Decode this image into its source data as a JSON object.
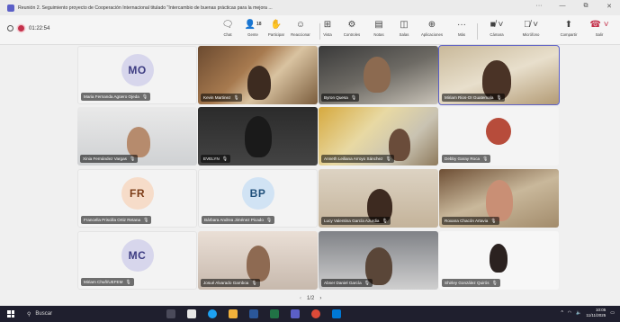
{
  "window": {
    "title": "Reunión 2. Seguimiento proyecto de Cooperación Internacional titulado \"Intercambio de buenas prácticas para la mejora ...",
    "controls": [
      "···",
      "—",
      "⧉",
      "✕"
    ]
  },
  "meeting": {
    "timer": "01:22:54",
    "toolbar": [
      {
        "id": "chat",
        "label": "Chat",
        "icon": "chat-icon"
      },
      {
        "id": "people",
        "label": "Gente",
        "icon": "people-icon",
        "count": "18"
      },
      {
        "id": "raise",
        "label": "Participar",
        "icon": "hand-icon"
      },
      {
        "id": "react",
        "label": "Reaccionar",
        "icon": "smile-icon"
      },
      {
        "id": "view",
        "label": "Vista",
        "icon": "view-icon"
      },
      {
        "id": "controls",
        "label": "Controles",
        "icon": "controls-icon"
      },
      {
        "id": "notes",
        "label": "Notas",
        "icon": "notes-icon"
      },
      {
        "id": "rooms",
        "label": "Salas",
        "icon": "rooms-icon"
      },
      {
        "id": "apps",
        "label": "Aplicaciones",
        "icon": "apps-icon"
      },
      {
        "id": "more",
        "label": "Más",
        "icon": "more-icon"
      },
      {
        "id": "camera",
        "label": "Cámara",
        "icon": "camera-off-icon"
      },
      {
        "id": "mic",
        "label": "Micrófono",
        "icon": "mic-off-icon"
      },
      {
        "id": "share",
        "label": "Compartir",
        "icon": "share-icon"
      }
    ],
    "leave_label": "Salir",
    "pager": "1/2"
  },
  "participants": [
    {
      "name": "Maria Fernanda Agüero Ojeda",
      "initials": "MO",
      "kind": "avatar",
      "color": "purple"
    },
    {
      "name": "Kevin Martinez",
      "kind": "video",
      "v": "v1"
    },
    {
      "name": "Byron Quesa",
      "kind": "video",
      "v": "v2"
    },
    {
      "name": "Miriam Rios-OI Guatemala",
      "kind": "video",
      "v": "v3",
      "active": true
    },
    {
      "name": "Xinia Fernández Vargas",
      "kind": "video",
      "v": "v4"
    },
    {
      "name": "EVELYN",
      "kind": "video",
      "v": "v5"
    },
    {
      "name": "Anneth Leiliana Arroyo Sánchez",
      "kind": "video",
      "v": "v6"
    },
    {
      "name": "Debby Garay Roca",
      "kind": "video",
      "v": "v7"
    },
    {
      "name": "Francella Priscilla Ortiz Retana",
      "initials": "FR",
      "kind": "avatar",
      "color": "peach"
    },
    {
      "name": "Bárbara Andrea Jiménez Picado",
      "initials": "BP",
      "kind": "avatar",
      "color": "blue"
    },
    {
      "name": "Lucy Valentina García Azurdia",
      "kind": "video",
      "v": "v8"
    },
    {
      "name": "Roxana Chacón Artavia",
      "kind": "video",
      "v": "v9"
    },
    {
      "name": "Miriam Chuñ/UEFEM",
      "initials": "MC",
      "kind": "avatar",
      "color": "purple"
    },
    {
      "name": "Josué Alvarado Gamboa",
      "kind": "video",
      "v": "v10"
    },
    {
      "name": "Abner Daniel García",
      "kind": "video",
      "v": "v11"
    },
    {
      "name": "Shirley González Quirós",
      "kind": "video",
      "v": "v12"
    }
  ],
  "taskbar": {
    "search_label": "Buscar",
    "time": "10:05",
    "date": "11/11/2025"
  }
}
